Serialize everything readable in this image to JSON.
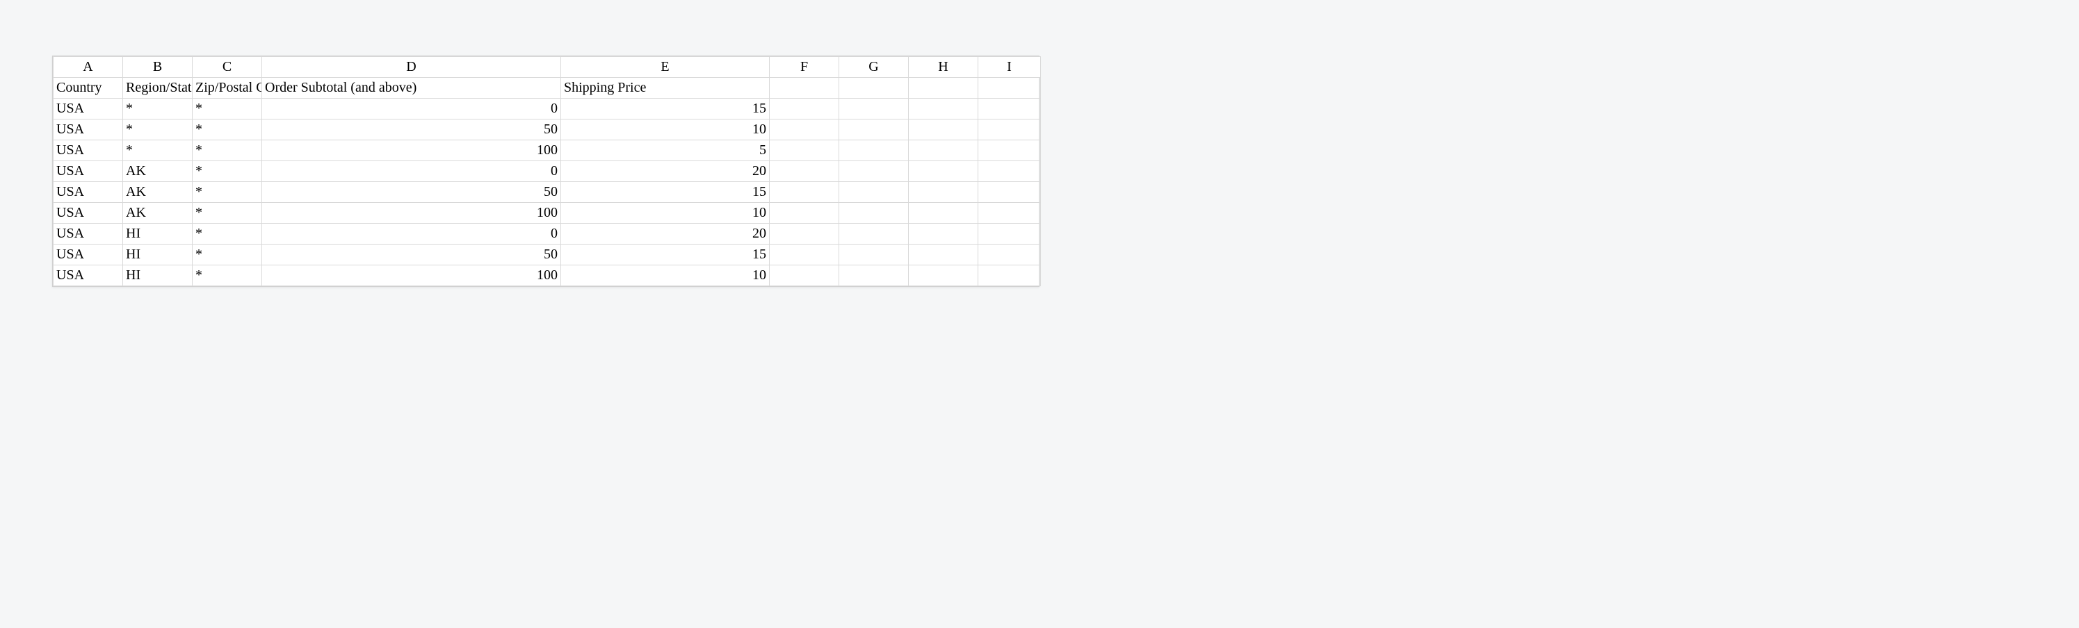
{
  "columns": [
    "A",
    "B",
    "C",
    "D",
    "E",
    "F",
    "G",
    "H",
    "I"
  ],
  "headerRow": {
    "A": "Country",
    "B": "Region/State",
    "C": "Zip/Postal Code",
    "D": "Order Subtotal (and above)",
    "E": "Shipping Price",
    "F": "",
    "G": "",
    "H": "",
    "I": ""
  },
  "rows": [
    {
      "A": "USA",
      "B": "*",
      "C": "*",
      "D": "0",
      "E": "15",
      "F": "",
      "G": "",
      "H": "",
      "I": ""
    },
    {
      "A": "USA",
      "B": "*",
      "C": "*",
      "D": "50",
      "E": "10",
      "F": "",
      "G": "",
      "H": "",
      "I": ""
    },
    {
      "A": "USA",
      "B": "*",
      "C": "*",
      "D": "100",
      "E": "5",
      "F": "",
      "G": "",
      "H": "",
      "I": ""
    },
    {
      "A": "USA",
      "B": "AK",
      "C": "*",
      "D": "0",
      "E": "20",
      "F": "",
      "G": "",
      "H": "",
      "I": ""
    },
    {
      "A": "USA",
      "B": "AK",
      "C": "*",
      "D": "50",
      "E": "15",
      "F": "",
      "G": "",
      "H": "",
      "I": ""
    },
    {
      "A": "USA",
      "B": "AK",
      "C": "*",
      "D": "100",
      "E": "10",
      "F": "",
      "G": "",
      "H": "",
      "I": ""
    },
    {
      "A": "USA",
      "B": "HI",
      "C": "*",
      "D": "0",
      "E": "20",
      "F": "",
      "G": "",
      "H": "",
      "I": ""
    },
    {
      "A": "USA",
      "B": "HI",
      "C": "*",
      "D": "50",
      "E": "15",
      "F": "",
      "G": "",
      "H": "",
      "I": ""
    },
    {
      "A": "USA",
      "B": "HI",
      "C": "*",
      "D": "100",
      "E": "10",
      "F": "",
      "G": "",
      "H": "",
      "I": ""
    }
  ]
}
